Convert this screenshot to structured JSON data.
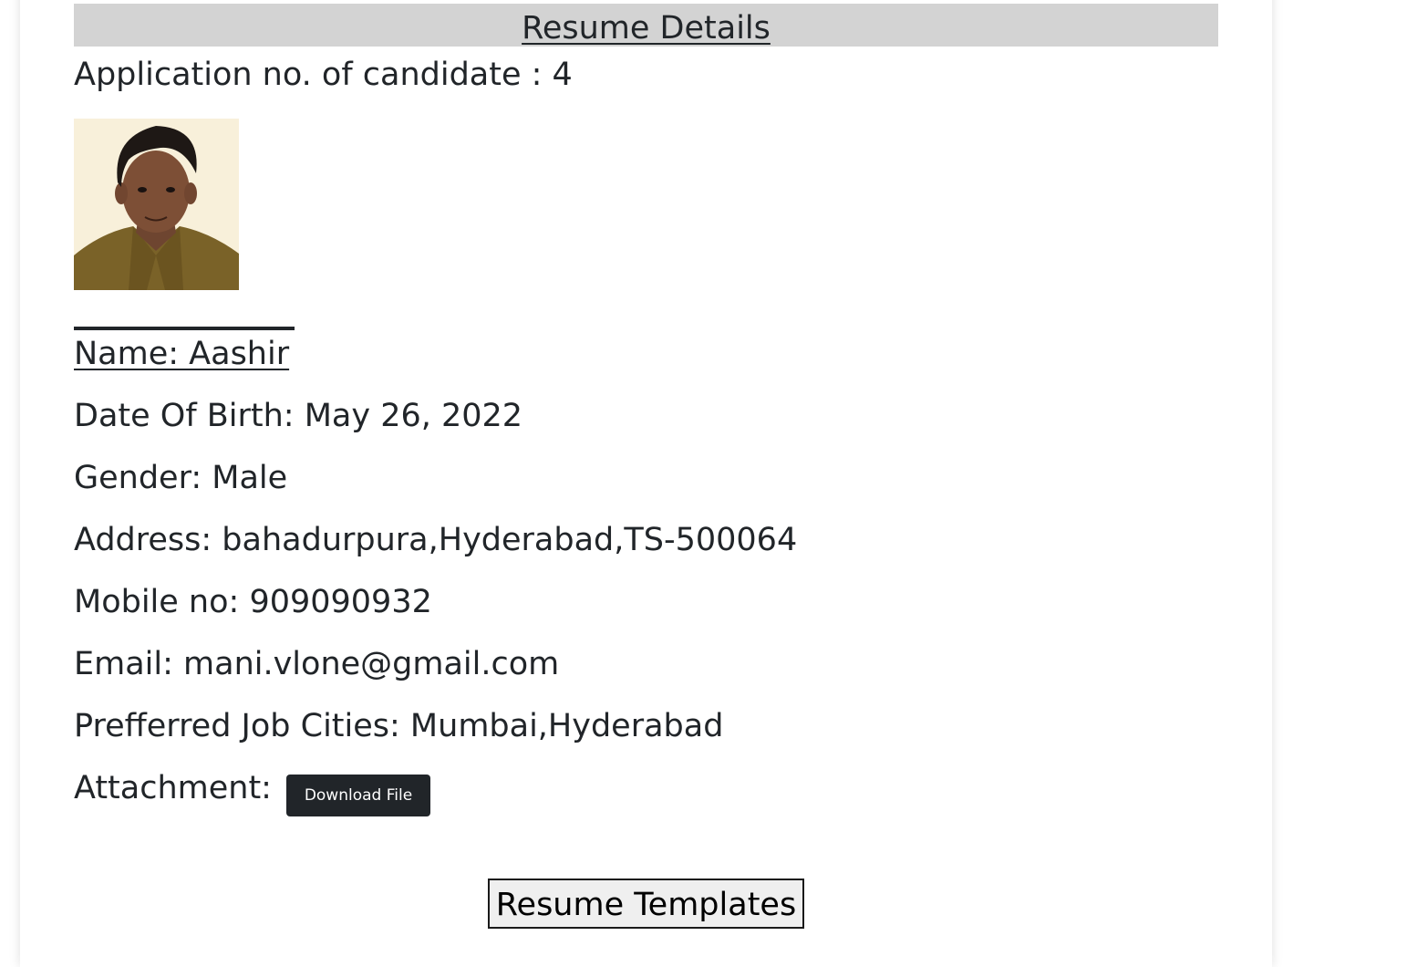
{
  "header": {
    "title": "Resume Details"
  },
  "candidate": {
    "application_no": "Application no. of candidate : 4",
    "photo_alt": "candidate-photo",
    "name": "Name: Aashir",
    "dob": "Date Of Birth: May 26, 2022",
    "gender": "Gender: Male",
    "address": "Address: bahadurpura,Hyderabad,TS-500064",
    "mobile": "Mobile no: 909090932",
    "email": "Email: mani.vlone@gmail.com",
    "cities": "Prefferred Job Cities: Mumbai,Hyderabad",
    "attachment_label": "Attachment:"
  },
  "buttons": {
    "download": "Download File",
    "templates": "Resume Templates"
  },
  "colors": {
    "header_bg": "#d3d3d3",
    "text": "#212529",
    "dark_button": "#212529"
  }
}
